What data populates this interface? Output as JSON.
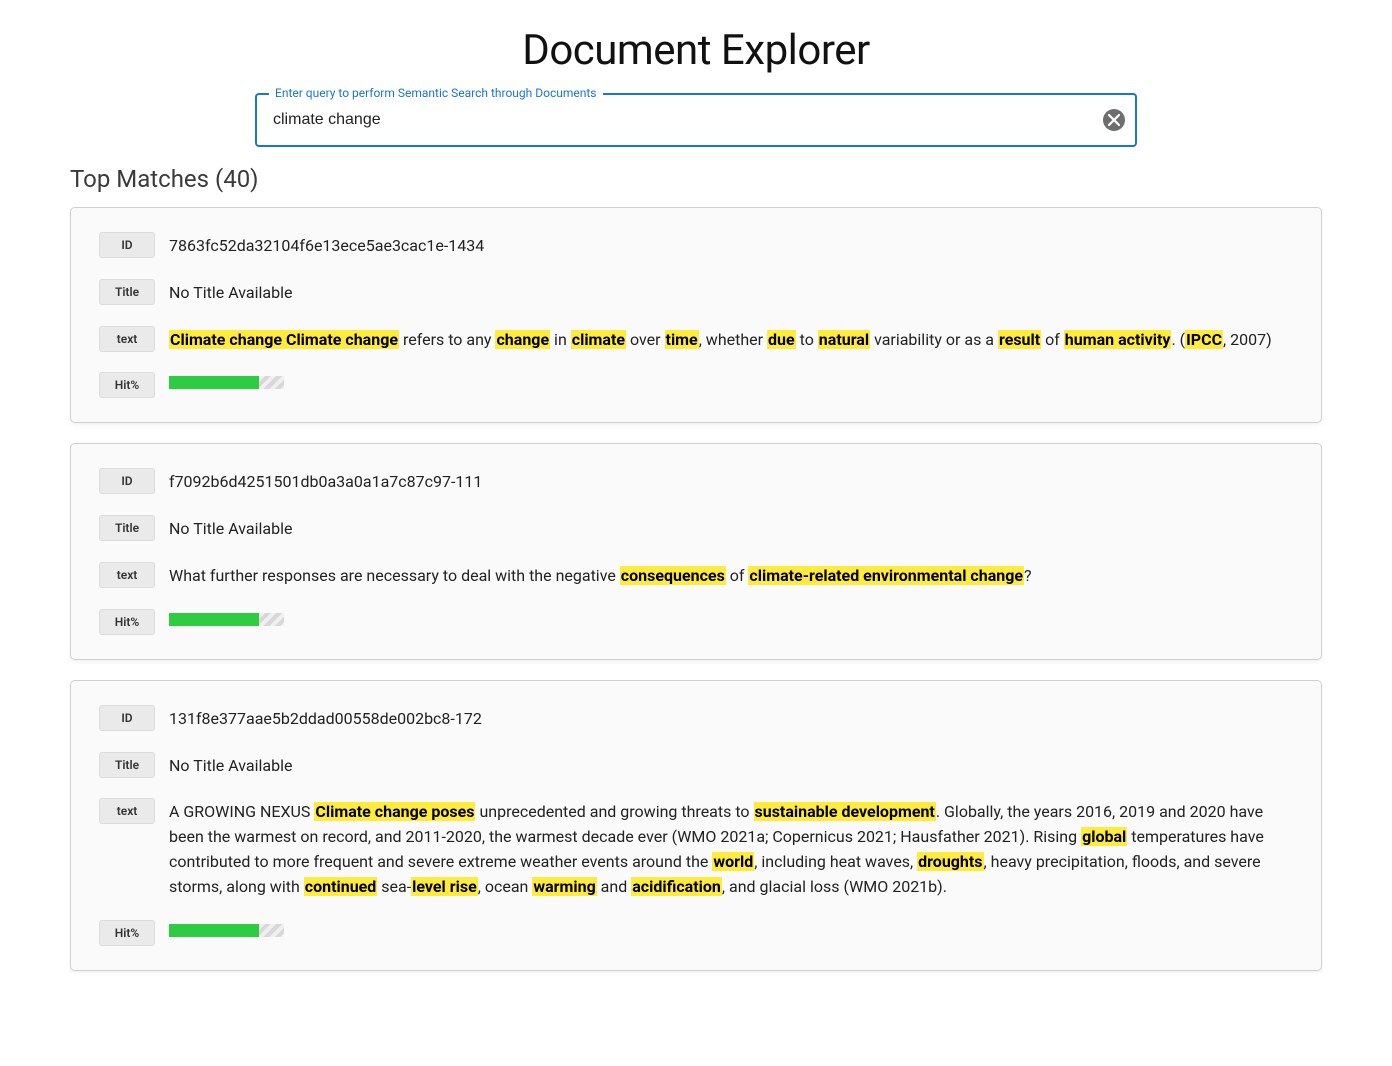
{
  "header": {
    "title": "Document Explorer"
  },
  "search": {
    "label": "Enter query to perform Semantic Search through Documents",
    "value": "climate change"
  },
  "resultsHeading": "Top Matches (40)",
  "labels": {
    "id": "ID",
    "title": "Title",
    "text": "text",
    "hit": "Hit%"
  },
  "results": [
    {
      "id": "7863fc52da32104f6e13ece5ae3cac1e-1434",
      "title": "No Title Available",
      "text_html": "<mark>Climate change Climate change</mark> refers to any <mark>change</mark> in <mark>climate</mark> over <mark>time</mark>, whether <mark>due</mark> to <mark>natural</mark> variability or as a <mark>result</mark> of <mark>human activity</mark>. (<mark>IPCC</mark>, 2007)",
      "hit_percent": 78
    },
    {
      "id": "f7092b6d4251501db0a3a0a1a7c87c97-111",
      "title": "No Title Available",
      "text_html": "What further responses are necessary to deal with the negative <mark>consequences</mark> of <mark>climate-related environmental change</mark>?",
      "hit_percent": 78
    },
    {
      "id": "131f8e377aae5b2ddad00558de002bc8-172",
      "title": "No Title Available",
      "text_html": "A GROWING NEXUS <mark>Climate change poses</mark> unprecedented and growing threats to <mark>sustainable development</mark>. Globally, the years 2016, 2019 and 2020 have been the warmest on record, and 2011-2020, the warmest decade ever (WMO 2021a; Copernicus 2021; Hausfather 2021). Rising <mark>global</mark> temperatures have contributed to more frequent and severe extreme weather events around the <mark>world</mark>, including heat waves, <mark>droughts</mark>, heavy precipitation, floods, and severe storms, along with <mark>continued</mark> sea-<mark>level rise</mark>, ocean <mark>warming</mark> and <mark>acidification</mark>, and glacial loss (WMO 2021b).",
      "hit_percent": 78
    }
  ]
}
